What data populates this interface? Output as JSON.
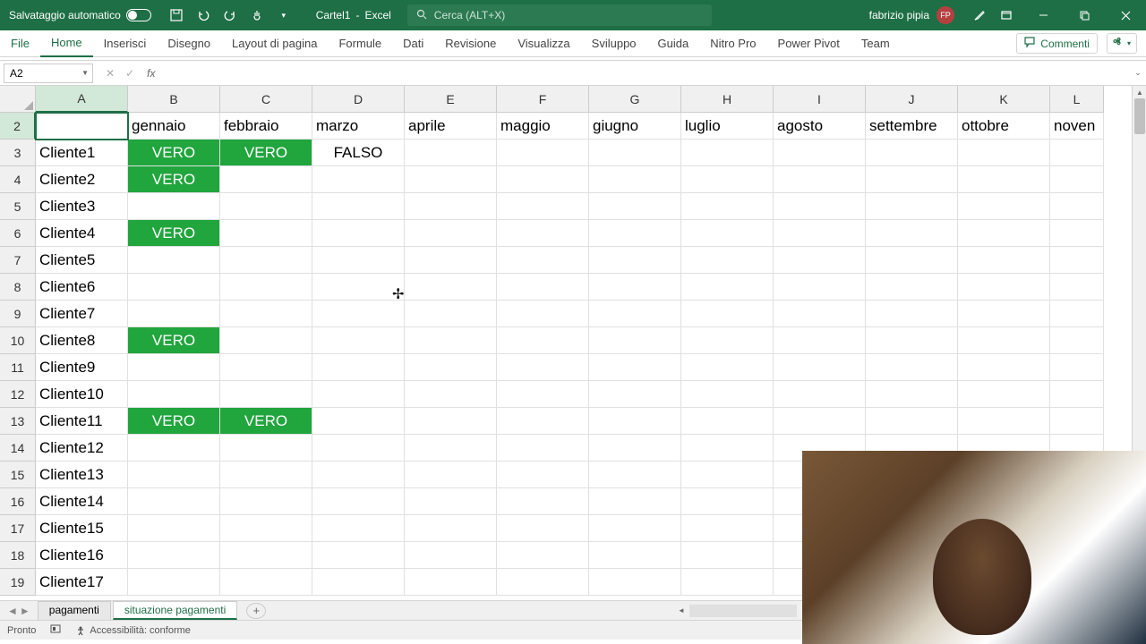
{
  "titlebar": {
    "autosave_label": "Salvataggio automatico",
    "doc_name": "Cartel1",
    "app_name": "Excel",
    "search_placeholder": "Cerca (ALT+X)",
    "user_name": "fabrizio pipia",
    "user_initials": "FP"
  },
  "ribbon": {
    "tabs": [
      "File",
      "Home",
      "Inserisci",
      "Disegno",
      "Layout di pagina",
      "Formule",
      "Dati",
      "Revisione",
      "Visualizza",
      "Sviluppo",
      "Guida",
      "Nitro Pro",
      "Power Pivot",
      "Team"
    ],
    "comments_label": "Commenti"
  },
  "formula": {
    "namebox": "A2",
    "value": ""
  },
  "columns": [
    "A",
    "B",
    "C",
    "D",
    "E",
    "F",
    "G",
    "H",
    "I",
    "J",
    "K",
    "L"
  ],
  "selected_col_index": 0,
  "headers_row": [
    "",
    "gennaio",
    "febbraio",
    "marzo",
    "aprile",
    "maggio",
    "giugno",
    "luglio",
    "agosto",
    "settembre",
    "ottobre",
    "noven"
  ],
  "rows": [
    {
      "n": 2,
      "sel": true
    },
    {
      "n": 3,
      "label": "Cliente1",
      "b": "VERO",
      "c": "VERO",
      "d": "FALSO",
      "b_green": true,
      "c_green": true
    },
    {
      "n": 4,
      "label": "Cliente2",
      "b": "VERO",
      "b_green": true
    },
    {
      "n": 5,
      "label": "Cliente3"
    },
    {
      "n": 6,
      "label": "Cliente4",
      "b": "VERO",
      "b_green": true
    },
    {
      "n": 7,
      "label": "Cliente5"
    },
    {
      "n": 8,
      "label": "Cliente6"
    },
    {
      "n": 9,
      "label": "Cliente7"
    },
    {
      "n": 10,
      "label": "Cliente8",
      "b": "VERO",
      "b_green": true
    },
    {
      "n": 11,
      "label": "Cliente9"
    },
    {
      "n": 12,
      "label": "Cliente10"
    },
    {
      "n": 13,
      "label": "Cliente11",
      "b": "VERO",
      "c": "VERO",
      "b_green": true,
      "c_green": true
    },
    {
      "n": 14,
      "label": "Cliente12"
    },
    {
      "n": 15,
      "label": "Cliente13"
    },
    {
      "n": 16,
      "label": "Cliente14"
    },
    {
      "n": 17,
      "label": "Cliente15"
    },
    {
      "n": 18,
      "label": "Cliente16"
    },
    {
      "n": 19,
      "label": "Cliente17"
    }
  ],
  "sheets": {
    "tabs": [
      "pagamenti",
      "situazione pagamenti"
    ],
    "active_index": 1
  },
  "status": {
    "ready": "Pronto",
    "accessibility": "Accessibilità: conforme"
  }
}
